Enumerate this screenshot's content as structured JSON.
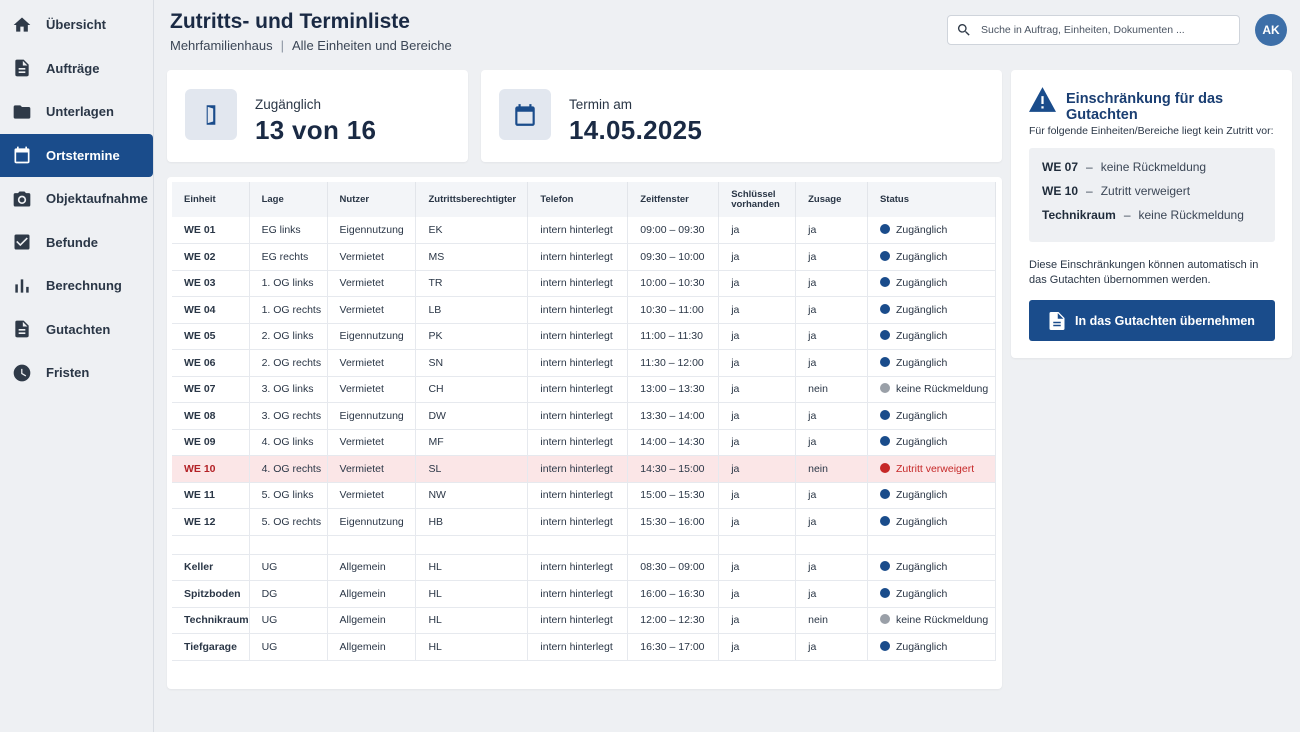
{
  "colors": {
    "accent": "#1a4c8b",
    "ok": "#1a4c8b",
    "pending": "#9aa0a8",
    "denied": "#c62828",
    "denied_row": "#fbe6e7"
  },
  "sidebar": {
    "items": [
      {
        "label": "Übersicht",
        "icon": "home-icon"
      },
      {
        "label": "Aufträge",
        "icon": "document-icon"
      },
      {
        "label": "Unterlagen",
        "icon": "folder-icon"
      },
      {
        "label": "Ortstermine",
        "icon": "calendar-icon",
        "active": true
      },
      {
        "label": "Objektaufnahme",
        "icon": "camera-icon"
      },
      {
        "label": "Befunde",
        "icon": "checkbox-icon"
      },
      {
        "label": "Berechnung",
        "icon": "bar-chart-icon"
      },
      {
        "label": "Gutachten",
        "icon": "document-icon"
      },
      {
        "label": "Fristen",
        "icon": "clock-icon"
      }
    ]
  },
  "header": {
    "title": "Zutritts- und Terminliste",
    "subtitle_left": "Mehrfamilienhaus",
    "subtitle_sep": "|",
    "subtitle_right": "Alle Einheiten und Bereiche",
    "search_placeholder": "Suche in Auftrag, Einheiten, Dokumenten ...",
    "avatar": "AK"
  },
  "stats": {
    "access": {
      "label": "Zugänglich",
      "value": "13 von 16",
      "icon": "door-icon"
    },
    "appointment": {
      "label": "Termin am",
      "value": "14.05.2025",
      "icon": "calendar-icon"
    }
  },
  "table": {
    "columns": [
      "Einheit",
      "Lage",
      "Nutzer",
      "Zutrittsberechtigter",
      "Telefon",
      "Zeitfenster",
      "Schlüssel vorhanden",
      "Zusage",
      "Status"
    ],
    "groups": [
      [
        [
          "WE 01",
          "EG links",
          "Eigennutzung",
          "EK",
          "intern hinterlegt",
          "09:00 – 09:30",
          "ja",
          "ja",
          "Zugänglich",
          "ok"
        ],
        [
          "WE 02",
          "EG rechts",
          "Vermietet",
          "MS",
          "intern hinterlegt",
          "09:30 – 10:00",
          "ja",
          "ja",
          "Zugänglich",
          "ok"
        ],
        [
          "WE 03",
          "1. OG links",
          "Vermietet",
          "TR",
          "intern hinterlegt",
          "10:00 – 10:30",
          "ja",
          "ja",
          "Zugänglich",
          "ok"
        ],
        [
          "WE 04",
          "1. OG rechts",
          "Vermietet",
          "LB",
          "intern hinterlegt",
          "10:30 – 11:00",
          "ja",
          "ja",
          "Zugänglich",
          "ok"
        ],
        [
          "WE 05",
          "2. OG links",
          "Eigennutzung",
          "PK",
          "intern hinterlegt",
          "11:00 – 11:30",
          "ja",
          "ja",
          "Zugänglich",
          "ok"
        ],
        [
          "WE 06",
          "2. OG rechts",
          "Vermietet",
          "SN",
          "intern hinterlegt",
          "11:30 – 12:00",
          "ja",
          "ja",
          "Zugänglich",
          "ok"
        ],
        [
          "WE 07",
          "3. OG links",
          "Vermietet",
          "CH",
          "intern hinterlegt",
          "13:00 – 13:30",
          "ja",
          "nein",
          "keine Rückmeldung",
          "pending"
        ],
        [
          "WE 08",
          "3. OG rechts",
          "Eigennutzung",
          "DW",
          "intern hinterlegt",
          "13:30 – 14:00",
          "ja",
          "ja",
          "Zugänglich",
          "ok"
        ],
        [
          "WE 09",
          "4. OG links",
          "Vermietet",
          "MF",
          "intern hinterlegt",
          "14:00 – 14:30",
          "ja",
          "ja",
          "Zugänglich",
          "ok"
        ],
        [
          "WE 10",
          "4. OG rechts",
          "Vermietet",
          "SL",
          "intern hinterlegt",
          "14:30 – 15:00",
          "ja",
          "nein",
          "Zutritt verweigert",
          "denied"
        ],
        [
          "WE 11",
          "5. OG links",
          "Vermietet",
          "NW",
          "intern hinterlegt",
          "15:00 – 15:30",
          "ja",
          "ja",
          "Zugänglich",
          "ok"
        ],
        [
          "WE 12",
          "5. OG rechts",
          "Eigennutzung",
          "HB",
          "intern hinterlegt",
          "15:30 – 16:00",
          "ja",
          "ja",
          "Zugänglich",
          "ok"
        ]
      ],
      [
        [
          "Keller",
          "UG",
          "Allgemein",
          "HL",
          "intern hinterlegt",
          "08:30 – 09:00",
          "ja",
          "ja",
          "Zugänglich",
          "ok"
        ],
        [
          "Spitzboden",
          "DG",
          "Allgemein",
          "HL",
          "intern hinterlegt",
          "16:00 – 16:30",
          "ja",
          "ja",
          "Zugänglich",
          "ok"
        ],
        [
          "Technikraum",
          "UG",
          "Allgemein",
          "HL",
          "intern hinterlegt",
          "12:00 – 12:30",
          "ja",
          "nein",
          "keine Rückmeldung",
          "pending"
        ],
        [
          "Tiefgarage",
          "UG",
          "Allgemein",
          "HL",
          "intern hinterlegt",
          "16:30 – 17:00",
          "ja",
          "ja",
          "Zugänglich",
          "ok"
        ]
      ]
    ]
  },
  "restriction": {
    "title": "Einschränkung für das Gutachten",
    "intro": "Für folgende Einheiten/Bereiche liegt kein Zutritt vor:",
    "items": [
      {
        "unit": "WE 07",
        "dash": "–",
        "text": "keine Rückmeldung"
      },
      {
        "unit": "WE 10",
        "dash": "–",
        "text": "Zutritt verweigert"
      },
      {
        "unit": "Technikraum",
        "dash": "–",
        "text": "keine Rückmeldung"
      }
    ],
    "note": "Diese Einschränkungen können automatisch in das Gutachten übernommen werden.",
    "button": "In das Gutachten übernehmen"
  }
}
